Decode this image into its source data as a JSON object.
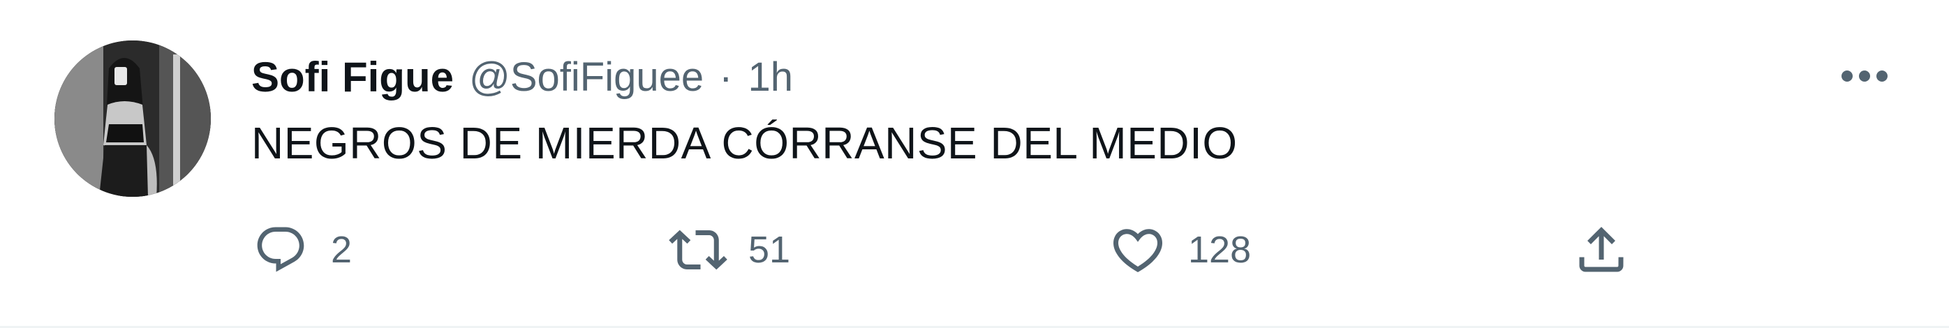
{
  "tweet": {
    "author": {
      "display_name": "Sofi Figue",
      "handle": "@SofiFiguee"
    },
    "separator": "·",
    "timestamp": "1h",
    "text": "NEGROS DE MIERDA CÓRRANSE DEL MEDIO",
    "actions": {
      "reply_count": "2",
      "retweet_count": "51",
      "like_count": "128"
    }
  },
  "icons": {
    "more": "more-horizontal-icon",
    "reply": "reply-icon",
    "retweet": "retweet-icon",
    "like": "heart-icon",
    "share": "share-icon"
  },
  "colors": {
    "text_primary": "#0f1419",
    "text_secondary": "#536471",
    "border": "#eff3f4"
  }
}
